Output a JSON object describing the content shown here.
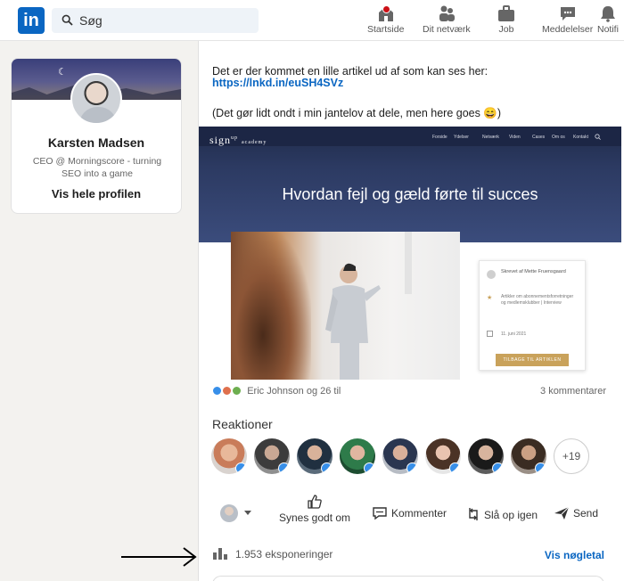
{
  "nav": {
    "logo": "in",
    "search_placeholder": "Søg",
    "items": [
      {
        "label": "Startside",
        "icon": "home-icon"
      },
      {
        "label": "Dit netværk",
        "icon": "network-icon"
      },
      {
        "label": "Job",
        "icon": "briefcase-icon"
      },
      {
        "label": "Meddelelser",
        "icon": "messaging-icon"
      },
      {
        "label": "Notifi",
        "icon": "bell-icon"
      }
    ]
  },
  "profile": {
    "name": "Karsten Madsen",
    "tagline": "CEO @ Morningscore - turning SEO into a game",
    "view_profile": "Vis hele profilen"
  },
  "post": {
    "line1": "Det er der kommet en lille artikel ud af som kan ses her:",
    "link": "https://lnkd.in/euSH4SVz",
    "line2": "(Det gør lidt ondt i min jantelov at dele, men here goes 😄)",
    "article": {
      "logo_main": "sign",
      "logo_up": "up",
      "logo_sub": "academy",
      "menu": [
        "Forside",
        "Ydelser",
        "Netværk",
        "Viden",
        "Cases",
        "Om os",
        "Kontakt"
      ],
      "title": "Hvordan fejl og gæld førte til succes",
      "box_author": "Skrevet af Mette Fruensgaard",
      "box_tags": "Artikler om abonnementsforretninger og medlemsklubber | Interview",
      "box_date": "11. juni 2021",
      "box_button": "TILBAGE TIL ARTIKLEN"
    },
    "social_text": "Eric Johnson og 26 til",
    "comments": "3 kommentarer",
    "reactions_title": "Reaktioner",
    "reactions_more": "+19",
    "actions": {
      "like": "Synes godt om",
      "comment": "Kommenter",
      "repost": "Slå op igen",
      "send": "Send"
    },
    "impressions": "1.953 eksponeringer",
    "analytics_link": "Vis nøgletal"
  },
  "colors": {
    "accent": "#0a66c2",
    "gold": "#c9a25b",
    "navy": "#2c3a62"
  }
}
